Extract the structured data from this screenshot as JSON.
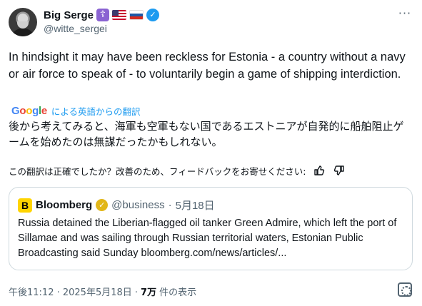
{
  "author": {
    "display_name": "Big Serge",
    "handle": "@witte_sergei",
    "badges": [
      "orthodox-cross-badge",
      "us-flag",
      "russia-flag",
      "verified-badge"
    ]
  },
  "tweet": {
    "text": "In hindsight it may have been reckless for Estonia - a country without a navy or air force to speak of - to voluntarily begin a game of shipping interdiction."
  },
  "translation": {
    "provider_label": "による英語からの翻訳",
    "text": "後から考えてみると、海軍も空軍もない国であるエストニアが自発的に船舶阻止ゲームを始めたのは無謀だったかもしれない。",
    "feedback_prompt": "この翻訳は正確でしたか？改善のため、フィードバックをお寄せください:"
  },
  "quote": {
    "name": "Bloomberg",
    "handle": "@business",
    "separator": "·",
    "date": "5月18日",
    "text": "Russia detained the Liberian-flagged oil tanker Green Admire, which left the port of Sillamae and was sailing through Russian territorial waters, Estonian Public Broadcasting said Sunday  bloomberg.com/news/articles/..."
  },
  "footer": {
    "timestamp": "午後11:12 · 2025年5月18日 ·",
    "views_count": "7万",
    "views_label": "件の表示"
  },
  "colors": {
    "accent": "#1d9bf0",
    "muted_text": "#536471",
    "border": "#cfd9de",
    "bloomberg_yellow": "#ffd400",
    "gold_verified": "#e2b719"
  }
}
